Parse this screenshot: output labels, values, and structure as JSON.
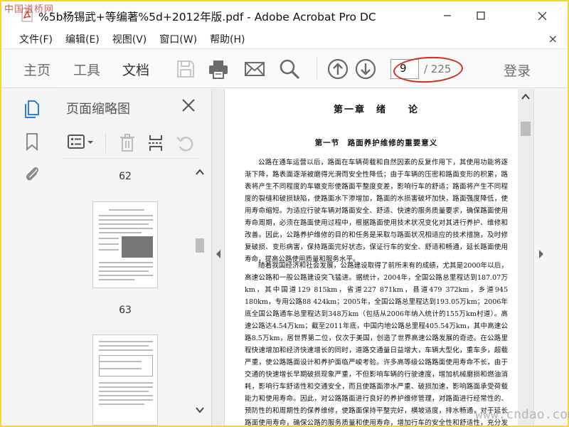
{
  "window": {
    "title": "%5b杨锡武+等编著%5d+2012年版.pdf - Adobe Acrobat Pro DC",
    "watermark_top": "中国道桥网",
    "watermark_bottom": "www.cndao.com"
  },
  "menu": {
    "items": [
      "文件(F)",
      "编辑(E)",
      "视图(V)",
      "窗口(W)",
      "帮助(H)"
    ],
    "close_glyph": "×"
  },
  "toolbar": {
    "tabs": [
      "主页",
      "工具",
      "文档"
    ],
    "active_tab": "文档",
    "page_current": "9",
    "page_total": "/ 225",
    "login": "登录"
  },
  "icons": {
    "rail": [
      "page-thumbnails-icon",
      "bookmark-icon",
      "attachment-icon"
    ],
    "toolbar": [
      "save-icon",
      "print-icon",
      "email-icon",
      "search-icon",
      "prev-page-icon",
      "next-page-icon"
    ],
    "panel_tools": [
      "options-menu-icon",
      "delete-icon",
      "extract-icon",
      "undo-icon"
    ]
  },
  "thumbnails": {
    "title": "页面缩略图",
    "labels": [
      "62",
      "63"
    ]
  },
  "document": {
    "chapter_title": "第一章　绪　　论",
    "section_title": "第一节　路面养护维修的重要意义",
    "paragraph_1": "公路在通车运营以后，路面在车辆荷载和自然因素的反复作用下，其使用功能将逐渐下降，路表面逐渐被磨得光滑而安全性降低；由于车辆的压密和路面变形的积累，路表将产生不同程度的车辙变形使路面平整度变差，影响行车的舒适；路面将产生不同程度的裂缝和破损缺陷，使路面水下渗增加，路面的水损害破坏加快，路面强度降低，使用寿命缩短。为适应行驶车辆对路面安全、舒适、快速的服务质量要求，确保路面使用寿命周期，必须在路面使用过程中，根据路面使用技术状况变化对其进行养护、维修和改善。因此，公路养护维修的目的和任务是采取与路面状况相适应的技术措施，及时修复破损、变形病害，保持路面完好状态，保证行车的安全、舒适和畅通，延长路面使用寿命，提高公路使用质量和服务水平。",
    "paragraph_2": "随着我国经济和社会发展，公路建设取得了前所未有的成绩，尤其是2000年以后，高速公路和一般公路建设突飞猛进。据统计，2004年，全国公路总里程达到187.07万km，其中国道129 815km，省道227 871km，县道479 372km，乡道945 180km，专用公路88 424km；2005年，全国公路总里程达到193.05万km；2006年底全国公路通车总里程达到348万km（包括从2006年纳入统计的155万km村道）。高速公路达4.54万km；截至2011年底，中国内地公路总里程405.54万km，其中高速公路8.5万km，居世界第二位，仅次于美国，创造了世界高速公路发展的奇迹。在公路里程快速增加和经济快速增长的同时，道路交通量日益增大，车辆大型化，重车多，超载严重，使公路路面设计和养护面临严峻考验。许多高等级公路路面使用寿命不长，由于交通的快速增长早期破损现象严重，不但影响车辆的行驶速度，增加机械磨损和燃油消耗，影响行车舒适性和交通安全，而且使路面渗水严重、破损加速，影响路面承受荷载能力和使用寿命。因此，对公路路面进行良好的养护维修管理，对路面进行经常性的、预防性的和周期性的保养维修，使路面保持平整完好，横坡适度，排水畅通，对于延长路面使用寿命，确保公路的服务质量和使用寿命，增加行车的安全性和舒适性，充分发挥公路投资的经济和社会效益具有重要的意义。"
  }
}
